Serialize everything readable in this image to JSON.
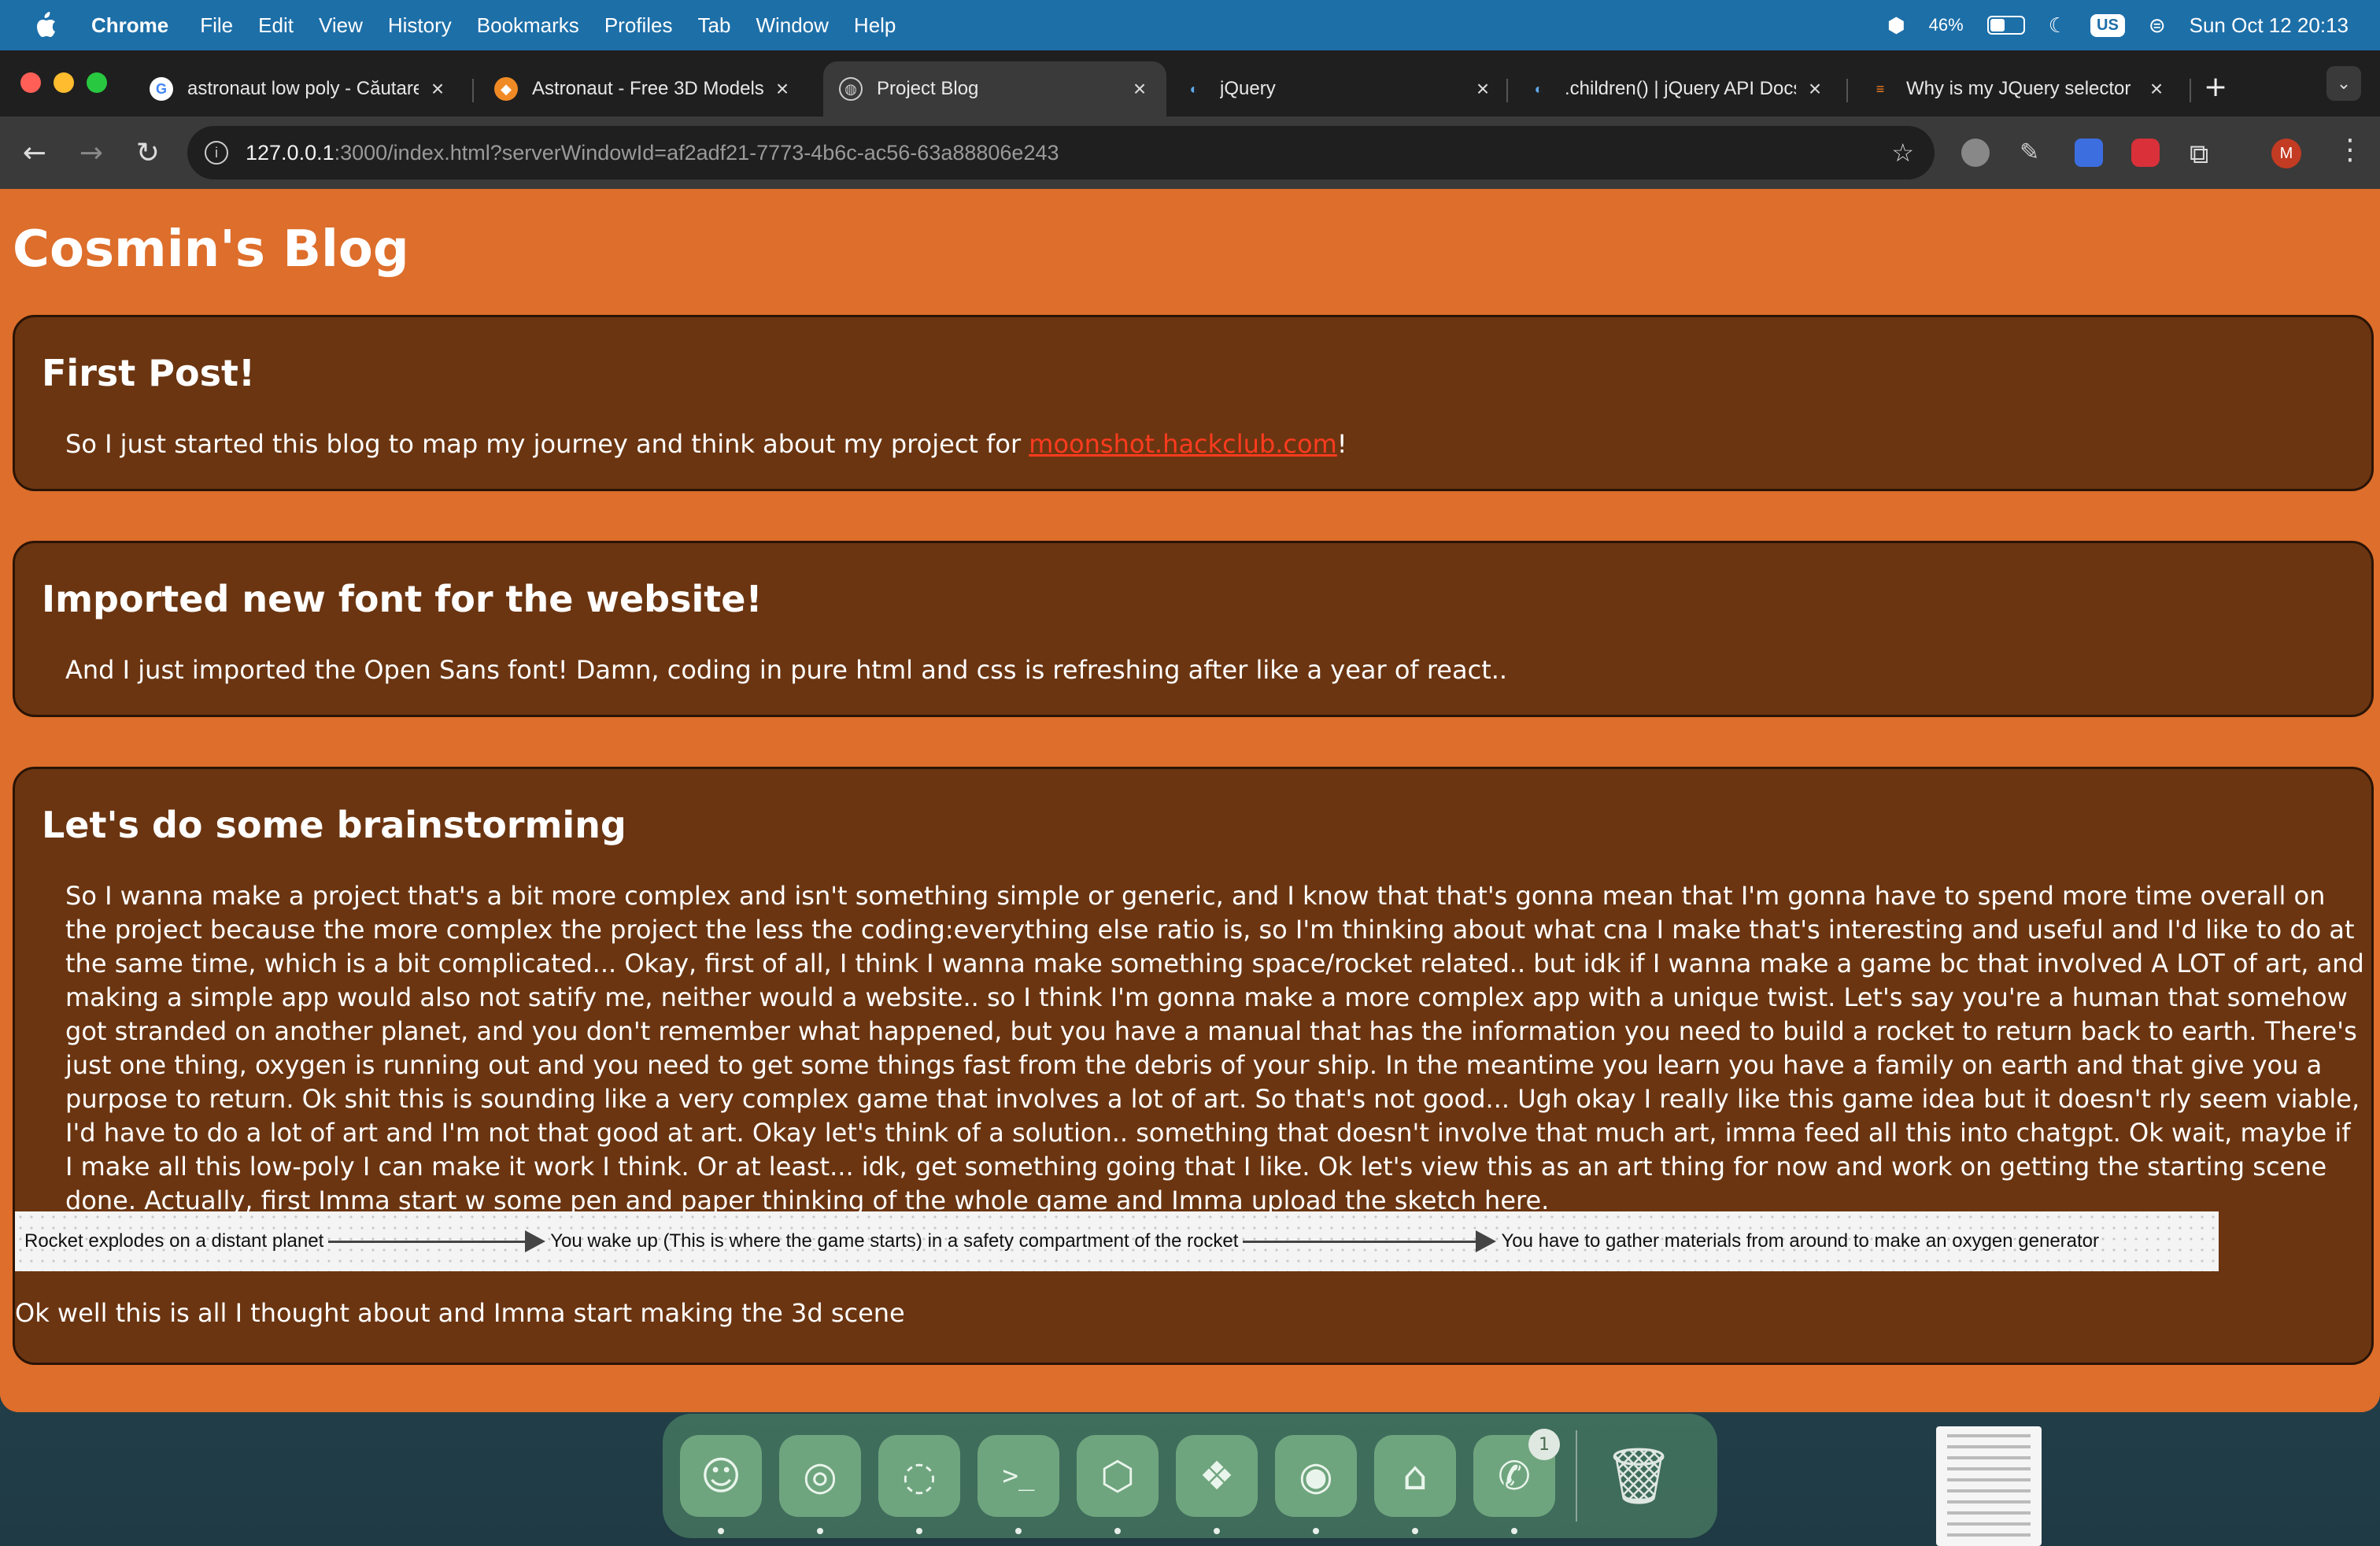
{
  "menubar": {
    "app_name": "Chrome",
    "items": [
      "File",
      "Edit",
      "View",
      "History",
      "Bookmarks",
      "Profiles",
      "Tab",
      "Window",
      "Help"
    ],
    "battery_percent": "46%",
    "battery_level": 0.46,
    "input_source": "US",
    "datetime": "Sun Oct 12  20:13"
  },
  "tabs": [
    {
      "title": "astronaut low poly - Căutare",
      "favicon": "google-icon",
      "active": false
    },
    {
      "title": "Astronaut - Free 3D Models",
      "favicon": "sketchfab-icon",
      "active": false
    },
    {
      "title": "Project Blog",
      "favicon": "globe-icon",
      "active": true
    },
    {
      "title": "jQuery",
      "favicon": "jquery-icon",
      "active": false
    },
    {
      "title": ".children() | jQuery API Docs",
      "favicon": "jquery-icon",
      "active": false
    },
    {
      "title": "Why is my JQuery selector",
      "favicon": "stackoverflow-icon",
      "active": false
    }
  ],
  "address_bar": {
    "host": "127.0.0.1",
    "path": ":3000/index.html?serverWindowId=af2adf21-7773-4b6c-ac56-63a88806e243"
  },
  "profile_initial": "M",
  "blog": {
    "title": "Cosmin's Blog",
    "posts": [
      {
        "heading": "First Post!",
        "body_before_link": "So I just started this blog to map my journey and think about my project for ",
        "link_text": "moonshot.hackclub.com",
        "body_after_link": "!"
      },
      {
        "heading": "Imported new font for the website!",
        "body": "And I just imported the Open Sans font! Damn, coding in pure html and css is refreshing after like a year of react.."
      },
      {
        "heading": "Let's do some brainstorming",
        "body": "So I wanna make a project that's a bit more complex and isn't something simple or generic, and I know that that's gonna mean that I'm gonna have to spend more time overall on the project because the more complex the project the less the coding:everything else ratio is, so I'm thinking about what cna I make that's interesting and useful and I'd like to do at the same time, which is a bit complicated... Okay, first of all, I think I wanna make something space/rocket related.. but idk if I wanna make a game bc that involved A LOT of art, and making a simple app would also not satify me, neither would a website.. so I think I'm gonna make a more complex app with a unique twist. Let's say you're a human that somehow got stranded on another planet, and you don't remember what happened, but you have a manual that has the information you need to build a rocket to return back to earth. There's just one thing, oxygen is running out and you need to get some things fast from the debris of your ship. In the meantime you learn you have a family on earth and that give you a purpose to return. Ok shit this is sounding like a very complex game that involves a lot of art. So that's not good... Ugh okay I really like this game idea but it doesn't rly seem viable, I'd have to do a lot of art and I'm not that good at art. Okay let's think of a solution.. something that doesn't involve that much art, imma feed all this into chatgpt. Ok wait, maybe if I make all this low-poly I can make it work I think. Or at least... idk, get something going that I like. Ok let's view this as an art thing for now and work on getting the starting scene done. Actually, first Imma start w some pen and paper thinking of the whole game and Imma upload the sketch here.",
        "flow_steps": [
          "Rocket explodes on a distant planet",
          "You wake up (This is where the game starts) in a safety compartment of the rocket",
          "You have to gather materials from around to make an oxygen generator"
        ],
        "after_flow": "Ok well this is all I thought about and Imma start making the 3d scene"
      }
    ]
  },
  "dock": {
    "apps": [
      "finder-icon",
      "chrome-icon",
      "edge-icon",
      "terminal-icon",
      "cube-app-icon",
      "figma-icon",
      "blender-icon",
      "launcher-icon",
      "whatsapp-icon"
    ],
    "whatsapp_badge": "1"
  }
}
